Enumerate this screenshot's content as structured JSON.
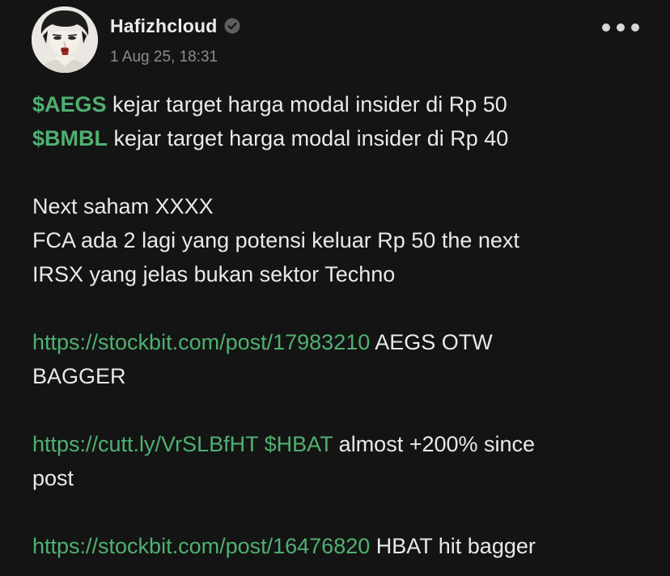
{
  "post": {
    "author": {
      "name": "Hafizhcloud",
      "verified": true,
      "avatar_icon": "avatar-portrait",
      "verified_icon": "verified-check-icon"
    },
    "timestamp": "1 Aug 25, 18:31",
    "more_icon": "more-dots-icon",
    "colors": {
      "background": "#141414",
      "text": "#e9e9e9",
      "ticker_link": "#4fb071",
      "muted": "#8c8c8c"
    },
    "body": {
      "line1": {
        "ticker": "$AEGS",
        "text": " kejar target harga modal insider di Rp 50"
      },
      "line2": {
        "ticker": "$BMBL",
        "text": " kejar target harga modal insider di Rp 40"
      },
      "para2": [
        "Next saham XXXX",
        "FCA ada 2 lagi yang potensi keluar Rp 50 the next",
        "IRSX yang jelas bukan sektor Techno"
      ],
      "para3": {
        "link": "https://stockbit.com/post/17983210",
        "text_a": " AEGS OTW",
        "text_b": "BAGGER"
      },
      "para4": {
        "link": "https://cutt.ly/VrSLBfHT",
        "ticker": "$HBAT",
        "text_a": " almost +200% since",
        "text_b": "post"
      },
      "para5": {
        "link": "https://stockbit.com/post/16476820",
        "text": " HBAT hit bagger"
      }
    }
  }
}
